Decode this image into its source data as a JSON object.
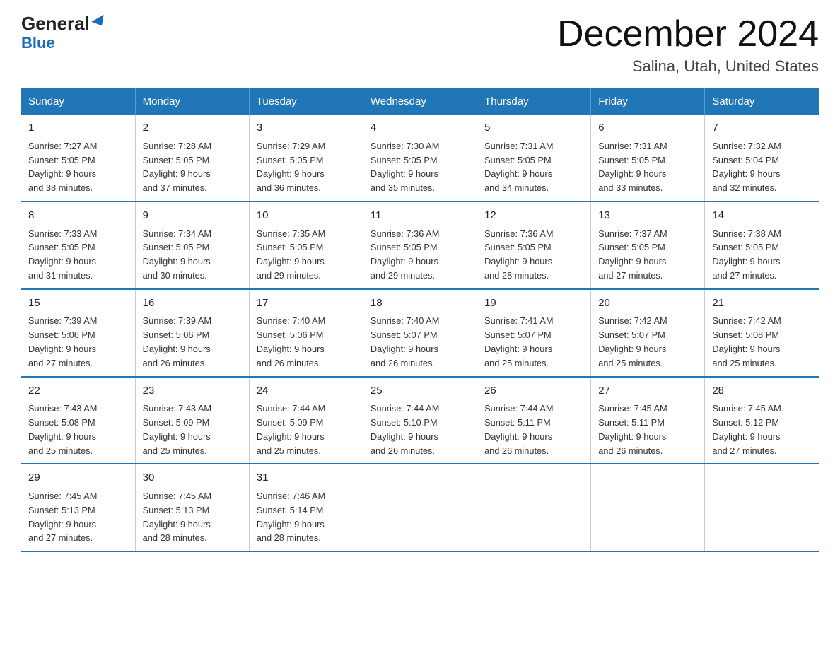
{
  "header": {
    "logo_main": "General",
    "logo_arrow": "▶",
    "logo_sub": "Blue",
    "title": "December 2024",
    "subtitle": "Salina, Utah, United States"
  },
  "days_of_week": [
    "Sunday",
    "Monday",
    "Tuesday",
    "Wednesday",
    "Thursday",
    "Friday",
    "Saturday"
  ],
  "weeks": [
    [
      {
        "num": "1",
        "sunrise": "7:27 AM",
        "sunset": "5:05 PM",
        "daylight": "9 hours and 38 minutes."
      },
      {
        "num": "2",
        "sunrise": "7:28 AM",
        "sunset": "5:05 PM",
        "daylight": "9 hours and 37 minutes."
      },
      {
        "num": "3",
        "sunrise": "7:29 AM",
        "sunset": "5:05 PM",
        "daylight": "9 hours and 36 minutes."
      },
      {
        "num": "4",
        "sunrise": "7:30 AM",
        "sunset": "5:05 PM",
        "daylight": "9 hours and 35 minutes."
      },
      {
        "num": "5",
        "sunrise": "7:31 AM",
        "sunset": "5:05 PM",
        "daylight": "9 hours and 34 minutes."
      },
      {
        "num": "6",
        "sunrise": "7:31 AM",
        "sunset": "5:05 PM",
        "daylight": "9 hours and 33 minutes."
      },
      {
        "num": "7",
        "sunrise": "7:32 AM",
        "sunset": "5:04 PM",
        "daylight": "9 hours and 32 minutes."
      }
    ],
    [
      {
        "num": "8",
        "sunrise": "7:33 AM",
        "sunset": "5:05 PM",
        "daylight": "9 hours and 31 minutes."
      },
      {
        "num": "9",
        "sunrise": "7:34 AM",
        "sunset": "5:05 PM",
        "daylight": "9 hours and 30 minutes."
      },
      {
        "num": "10",
        "sunrise": "7:35 AM",
        "sunset": "5:05 PM",
        "daylight": "9 hours and 29 minutes."
      },
      {
        "num": "11",
        "sunrise": "7:36 AM",
        "sunset": "5:05 PM",
        "daylight": "9 hours and 29 minutes."
      },
      {
        "num": "12",
        "sunrise": "7:36 AM",
        "sunset": "5:05 PM",
        "daylight": "9 hours and 28 minutes."
      },
      {
        "num": "13",
        "sunrise": "7:37 AM",
        "sunset": "5:05 PM",
        "daylight": "9 hours and 27 minutes."
      },
      {
        "num": "14",
        "sunrise": "7:38 AM",
        "sunset": "5:05 PM",
        "daylight": "9 hours and 27 minutes."
      }
    ],
    [
      {
        "num": "15",
        "sunrise": "7:39 AM",
        "sunset": "5:06 PM",
        "daylight": "9 hours and 27 minutes."
      },
      {
        "num": "16",
        "sunrise": "7:39 AM",
        "sunset": "5:06 PM",
        "daylight": "9 hours and 26 minutes."
      },
      {
        "num": "17",
        "sunrise": "7:40 AM",
        "sunset": "5:06 PM",
        "daylight": "9 hours and 26 minutes."
      },
      {
        "num": "18",
        "sunrise": "7:40 AM",
        "sunset": "5:07 PM",
        "daylight": "9 hours and 26 minutes."
      },
      {
        "num": "19",
        "sunrise": "7:41 AM",
        "sunset": "5:07 PM",
        "daylight": "9 hours and 25 minutes."
      },
      {
        "num": "20",
        "sunrise": "7:42 AM",
        "sunset": "5:07 PM",
        "daylight": "9 hours and 25 minutes."
      },
      {
        "num": "21",
        "sunrise": "7:42 AM",
        "sunset": "5:08 PM",
        "daylight": "9 hours and 25 minutes."
      }
    ],
    [
      {
        "num": "22",
        "sunrise": "7:43 AM",
        "sunset": "5:08 PM",
        "daylight": "9 hours and 25 minutes."
      },
      {
        "num": "23",
        "sunrise": "7:43 AM",
        "sunset": "5:09 PM",
        "daylight": "9 hours and 25 minutes."
      },
      {
        "num": "24",
        "sunrise": "7:44 AM",
        "sunset": "5:09 PM",
        "daylight": "9 hours and 25 minutes."
      },
      {
        "num": "25",
        "sunrise": "7:44 AM",
        "sunset": "5:10 PM",
        "daylight": "9 hours and 26 minutes."
      },
      {
        "num": "26",
        "sunrise": "7:44 AM",
        "sunset": "5:11 PM",
        "daylight": "9 hours and 26 minutes."
      },
      {
        "num": "27",
        "sunrise": "7:45 AM",
        "sunset": "5:11 PM",
        "daylight": "9 hours and 26 minutes."
      },
      {
        "num": "28",
        "sunrise": "7:45 AM",
        "sunset": "5:12 PM",
        "daylight": "9 hours and 27 minutes."
      }
    ],
    [
      {
        "num": "29",
        "sunrise": "7:45 AM",
        "sunset": "5:13 PM",
        "daylight": "9 hours and 27 minutes."
      },
      {
        "num": "30",
        "sunrise": "7:45 AM",
        "sunset": "5:13 PM",
        "daylight": "9 hours and 28 minutes."
      },
      {
        "num": "31",
        "sunrise": "7:46 AM",
        "sunset": "5:14 PM",
        "daylight": "9 hours and 28 minutes."
      },
      null,
      null,
      null,
      null
    ]
  ]
}
